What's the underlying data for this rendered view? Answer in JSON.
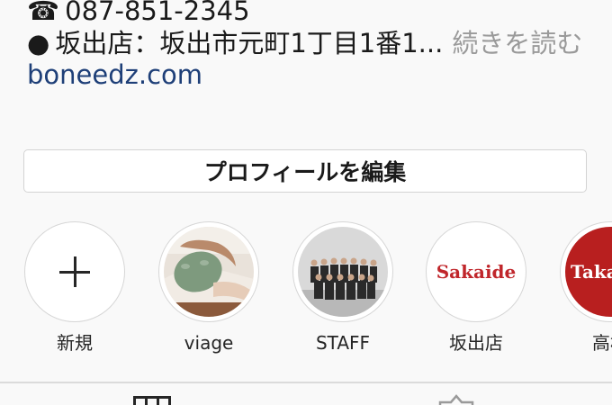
{
  "bio": {
    "phone_glyph": "☎",
    "phone": "087-851-2345",
    "address_glyph": "●",
    "address": "坂出店：坂出市元町1丁目1番1...",
    "read_more": "続きを読む",
    "website": "boneedz.com"
  },
  "edit_profile_label": "プロフィールを編集",
  "highlights": [
    {
      "label": "新規",
      "icon": "plus-icon"
    },
    {
      "label": "viage"
    },
    {
      "label": "STAFF"
    },
    {
      "label": "坂出店",
      "logo_text": "Sakaide"
    },
    {
      "label": "高松",
      "logo_text": "Takan"
    }
  ],
  "tab_icons": [
    "grid-tab-icon",
    "tagged-tab-icon"
  ],
  "colors": {
    "link": "#1e3f78",
    "sakaide_red": "#c0262b",
    "takamatsu_red": "#b81f1f",
    "border": "#d6d6d6",
    "background": "#f9f9f9"
  }
}
